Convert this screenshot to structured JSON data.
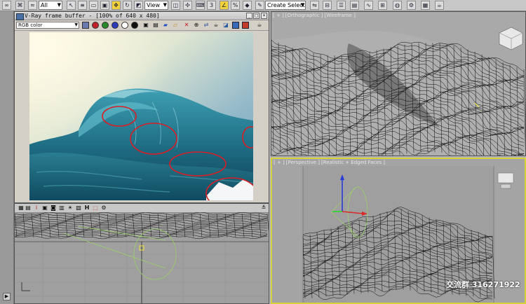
{
  "toolbar": {
    "selection_filter": "All",
    "reference_coord": "View",
    "selection_set_placeholder": "Create Selection Se"
  },
  "vfb": {
    "title": "V-Ray frame buffer - [100% of 640 x 480]",
    "channel": "RGB color",
    "min_label": "_",
    "max_label": "□",
    "close_label": "×"
  },
  "viewports": {
    "ortho": {
      "plus": "[ + ]",
      "view": "[Orthographic ]",
      "shading": "[Wireframe ]"
    },
    "perspective": {
      "plus": "[ + ]",
      "view": "[Perspective ]",
      "shading": "[Realistic + Edged Faces ]"
    }
  },
  "watermark": "交流群 316271922",
  "colors": {
    "active_viewport_border": "#d8d23a",
    "annotation_circle": "#d81f26",
    "gizmo_cone": "#9bd06a"
  }
}
